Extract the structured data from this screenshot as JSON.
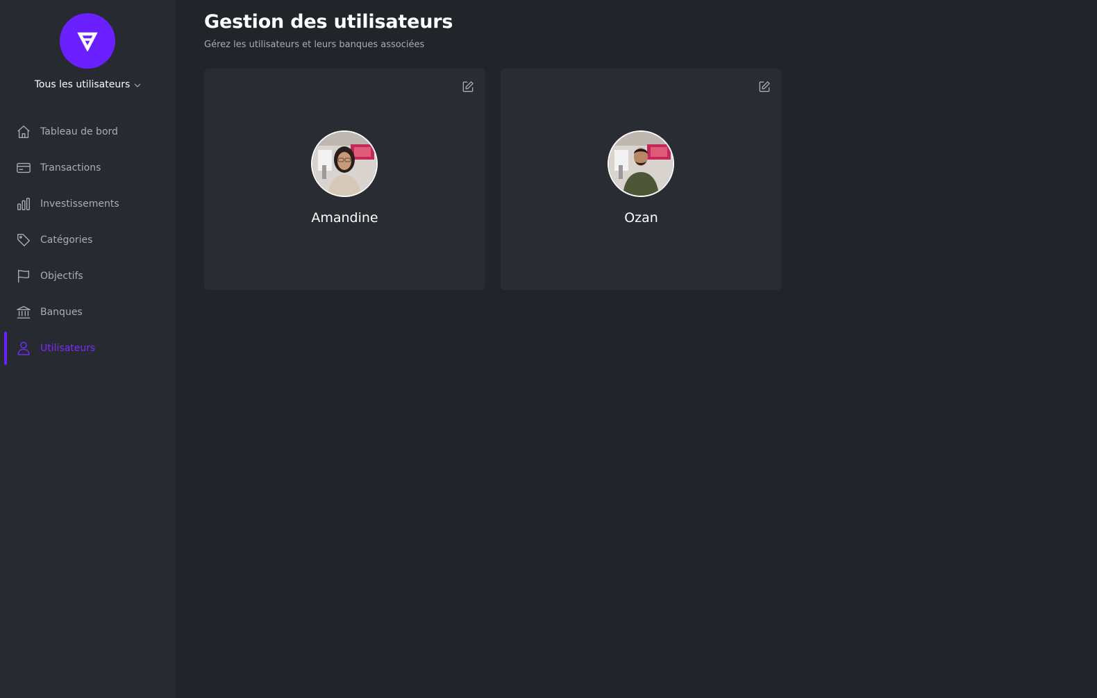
{
  "app": {
    "logo_icon": "app-logo-icon",
    "accent_color": "#6b20ff"
  },
  "sidebar": {
    "user_filter": "Tous les utilisateurs",
    "items": [
      {
        "label": "Tableau de bord",
        "icon": "home-icon",
        "active": false
      },
      {
        "label": "Transactions",
        "icon": "credit-card-icon",
        "active": false
      },
      {
        "label": "Investissements",
        "icon": "bar-chart-icon",
        "active": false
      },
      {
        "label": "Catégories",
        "icon": "tag-icon",
        "active": false
      },
      {
        "label": "Objectifs",
        "icon": "flag-icon",
        "active": false
      },
      {
        "label": "Banques",
        "icon": "bank-icon",
        "active": false
      },
      {
        "label": "Utilisateurs",
        "icon": "user-icon",
        "active": true
      }
    ]
  },
  "main": {
    "title": "Gestion des utilisateurs",
    "subtitle": "Gérez les utilisateurs et leurs banques associées",
    "users": [
      {
        "name": "Amandine"
      },
      {
        "name": "Ozan"
      }
    ]
  }
}
